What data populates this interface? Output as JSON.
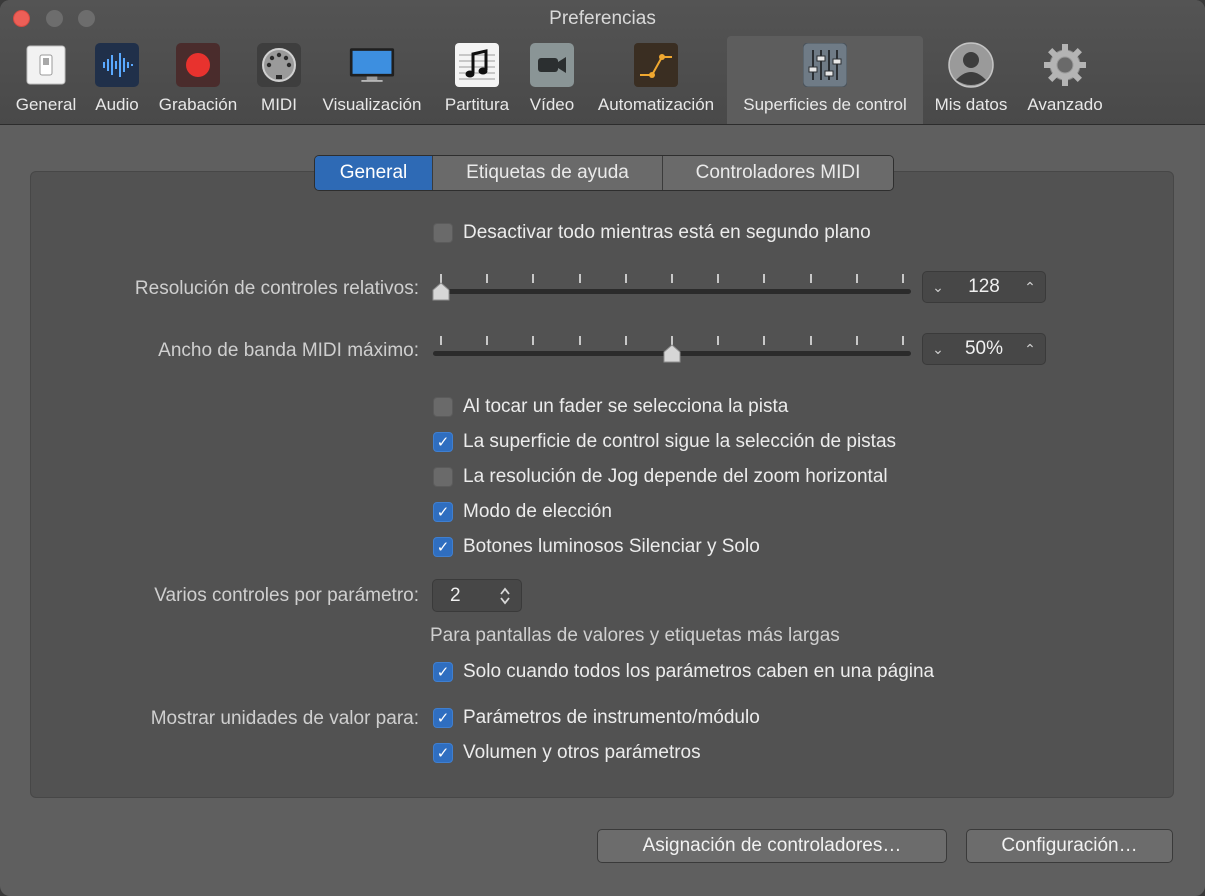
{
  "window": {
    "title": "Preferencias"
  },
  "toolbar": [
    {
      "label": "General",
      "icon": "switch-icon"
    },
    {
      "label": "Audio",
      "icon": "waveform-icon"
    },
    {
      "label": "Grabación",
      "icon": "record-icon"
    },
    {
      "label": "MIDI",
      "icon": "midi-plug-icon"
    },
    {
      "label": "Visualización",
      "icon": "display-icon"
    },
    {
      "label": "Partitura",
      "icon": "music-note-icon"
    },
    {
      "label": "Vídeo",
      "icon": "video-camera-icon"
    },
    {
      "label": "Automatización",
      "icon": "automation-icon"
    },
    {
      "label": "Superficies de control",
      "icon": "faders-icon",
      "selected": true
    },
    {
      "label": "Mis datos",
      "icon": "user-silhouette-icon"
    },
    {
      "label": "Avanzado",
      "icon": "gear-icon"
    }
  ],
  "tabs": [
    {
      "label": "General",
      "active": true
    },
    {
      "label": "Etiquetas de ayuda",
      "active": false
    },
    {
      "label": "Controladores MIDI",
      "active": false
    }
  ],
  "settings": {
    "disable_background": {
      "label": "Desactivar todo mientras está en segundo plano",
      "checked": false
    },
    "relative_resolution": {
      "label": "Resolución de controles relativos:",
      "value": "128",
      "slider_fraction": 0.0
    },
    "midi_bandwidth": {
      "label": "Ancho de banda MIDI máximo:",
      "value": "50%",
      "slider_fraction": 0.5
    },
    "options": [
      {
        "label": "Al tocar un fader se selecciona la pista",
        "checked": false
      },
      {
        "label": "La superficie de control sigue la selección de pistas",
        "checked": true
      },
      {
        "label": "La resolución de Jog depende del zoom horizontal",
        "checked": false
      },
      {
        "label": "Modo de elección",
        "checked": true
      },
      {
        "label": "Botones luminosos Silenciar y Solo",
        "checked": true
      }
    ],
    "multiple_controls": {
      "label": "Varios controles por parámetro:",
      "value": "2"
    },
    "multiple_controls_note": "Para pantallas de valores y etiquetas más largas",
    "only_when_fit": {
      "label": "Solo cuando todos los parámetros caben en una página",
      "checked": true
    },
    "value_units": {
      "label": "Mostrar unidades de valor para:",
      "items": [
        {
          "label": "Parámetros de instrumento/módulo",
          "checked": true
        },
        {
          "label": "Volumen y otros parámetros",
          "checked": true
        }
      ]
    }
  },
  "buttons": {
    "controller_assignments": "Asignación de controladores…",
    "setup": "Configuración…"
  },
  "colors": {
    "accent": "#2e6ab5",
    "record": "#e8322e",
    "close": "#ec5f57"
  }
}
